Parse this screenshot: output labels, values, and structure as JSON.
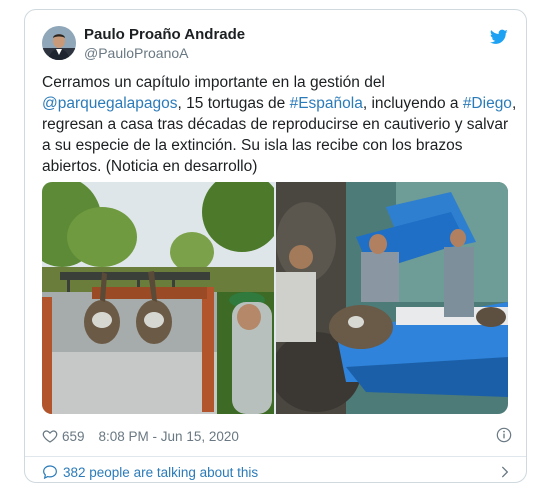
{
  "tweet": {
    "author": {
      "display_name": "Paulo Proaño Andrade",
      "handle": "@PauloProanoA",
      "avatar_icon": "user-avatar"
    },
    "brand_icon": "twitter-bird-icon",
    "text_segments": [
      {
        "text": "Cerramos un capítulo importante en la gestión del ",
        "link": false
      },
      {
        "text": "@parquegalapagos",
        "link": true
      },
      {
        "text": ", 15 tortugas de ",
        "link": false
      },
      {
        "text": "#Española",
        "link": true
      },
      {
        "text": ", incluyendo a ",
        "link": false
      },
      {
        "text": "#Diego",
        "link": true
      },
      {
        "text": ", regresan a casa tras décadas de reproducirse en cautiverio y salvar a su especie de la extinción. Su isla las recibe con los brazos abiertos. (Noticia en desarrollo)",
        "link": false
      }
    ],
    "media": [
      {
        "icon": "tortoises-in-truck-photo"
      },
      {
        "icon": "tortoise-boat-unloading-photo"
      }
    ],
    "likes": "659",
    "timestamp": "8:08 PM - Jun 15, 2020",
    "talking": "382 people are talking about this"
  },
  "colors": {
    "link": "#2b7bb9",
    "muted": "#697882",
    "border": "#cfd9de",
    "twitter_blue": "#1da1f2"
  }
}
